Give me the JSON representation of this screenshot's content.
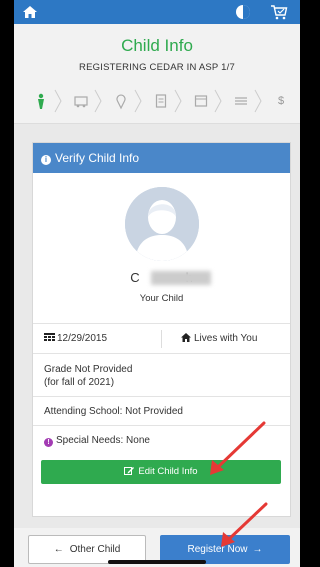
{
  "header": {
    "title": "Child Info",
    "subtitle": "REGISTERING CEDAR IN ASP 1/7",
    "steps": [
      "person-icon",
      "truck-icon",
      "pin-icon",
      "document-icon",
      "calendar-icon",
      "list-icon",
      "dollar-icon"
    ],
    "dollar_label": "$"
  },
  "card": {
    "heading": "Verify Child Info",
    "child_name_initial": "C",
    "child_name_final": "h",
    "relation": "Your Child",
    "dob": "12/29/2015",
    "lives_with": "Lives with You",
    "grade_label": "Grade",
    "grade_value": "Not Provided",
    "grade_note": "(for fall of 2021)",
    "school_label": "Attending School:",
    "school_value": "Not Provided",
    "special_needs_label": "Special Needs:",
    "special_needs_value": "None",
    "edit_button": "Edit Child Info"
  },
  "footer": {
    "other_child": "Other Child",
    "register_now": "Register Now"
  },
  "colors": {
    "primary_blue": "#2d78c4",
    "card_header_blue": "#4a87c9",
    "accent_green": "#2faa4f",
    "special_needs_purple": "#a33cb3",
    "annotation_red": "#e53935"
  },
  "icons": {
    "top_left": "home-icon",
    "top_middle": "theme-toggle-icon",
    "top_right": "cart-icon",
    "info": "info-icon",
    "calendar": "calendar-grid-icon",
    "home_small": "home-icon"
  }
}
